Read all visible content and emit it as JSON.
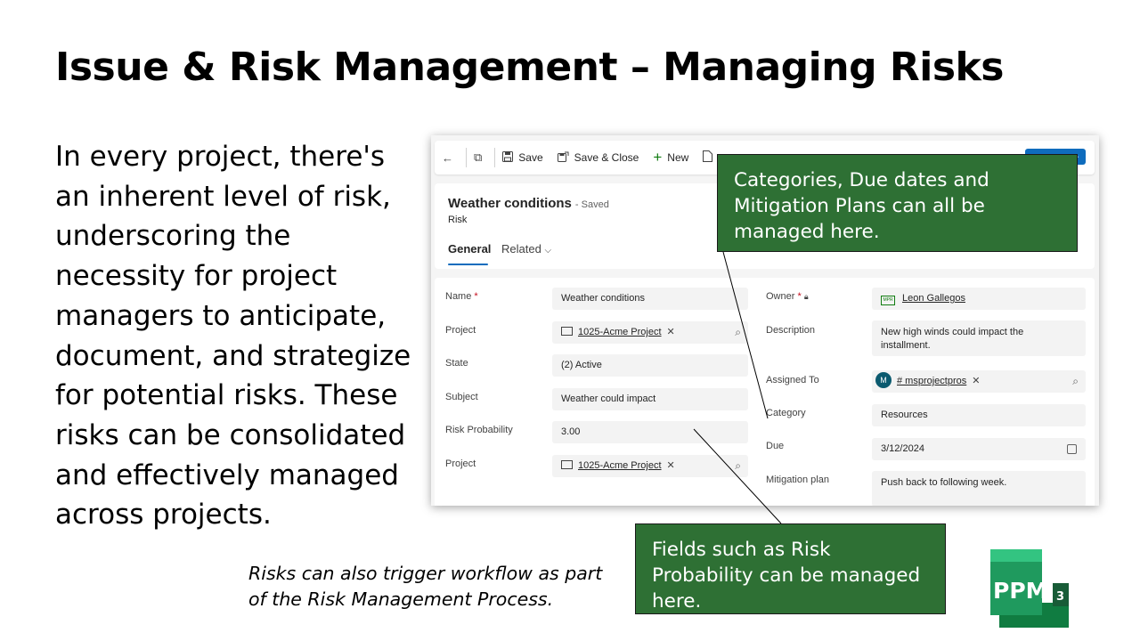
{
  "slide": {
    "title": "Issue & Risk Management – Managing Risks",
    "body_lines": [
      "In every project, there's",
      "an inherent level of risk,",
      "underscoring the",
      "necessity for project",
      "managers to anticipate,",
      "document, and strategize",
      "for potential risks. These",
      "risks can be consolidated",
      "and effectively managed",
      "across projects."
    ],
    "note_lines": [
      "Risks can also trigger workflow as part",
      "of the Risk Management Process."
    ]
  },
  "app": {
    "command_bar": {
      "back_icon": "←",
      "popout_icon": "⧉",
      "save_label": "Save",
      "save_close_label": "Save & Close",
      "new_label": "New"
    },
    "record": {
      "title": "Weather conditions",
      "saved_status": "- Saved",
      "type": "Risk",
      "tabs": [
        "General",
        "Related"
      ]
    },
    "form_left": {
      "name_label": "Name",
      "name_value": "Weather conditions",
      "project_label": "Project",
      "project_value": "1025-Acme Project",
      "state_label": "State",
      "state_value": "(2) Active",
      "subject_label": "Subject",
      "subject_value": "Weather could impact",
      "risk_probability_label": "Risk Probability",
      "risk_probability_value": "3.00",
      "project2_label": "Project",
      "project2_value": "1025-Acme Project"
    },
    "form_right": {
      "owner_label": "Owner",
      "owner_value": "Leon Gallegos",
      "owner_badge": "MPR",
      "description_label": "Description",
      "description_value": "New high winds could impact the installment.",
      "assigned_label": "Assigned To",
      "assigned_avatar": "M",
      "assigned_value": "# msprojectpros",
      "category_label": "Category",
      "category_value": "Resources",
      "due_label": "Due",
      "due_value": "3/12/2024",
      "mitigation_label": "Mitigation plan",
      "mitigation_value": "Push back to following week."
    }
  },
  "callouts": {
    "top_lines": [
      "Categories, Due dates and",
      "Mitigation Plans can all be",
      "managed here."
    ],
    "bottom_lines": [
      "Fields such as Risk",
      "Probability can be managed",
      "here."
    ]
  },
  "logo": {
    "text": "PPM",
    "superscript": "3"
  },
  "colors": {
    "callout_bg": "#2e7034",
    "accent": "#0f6cbd",
    "logo_green": "#21a366"
  }
}
